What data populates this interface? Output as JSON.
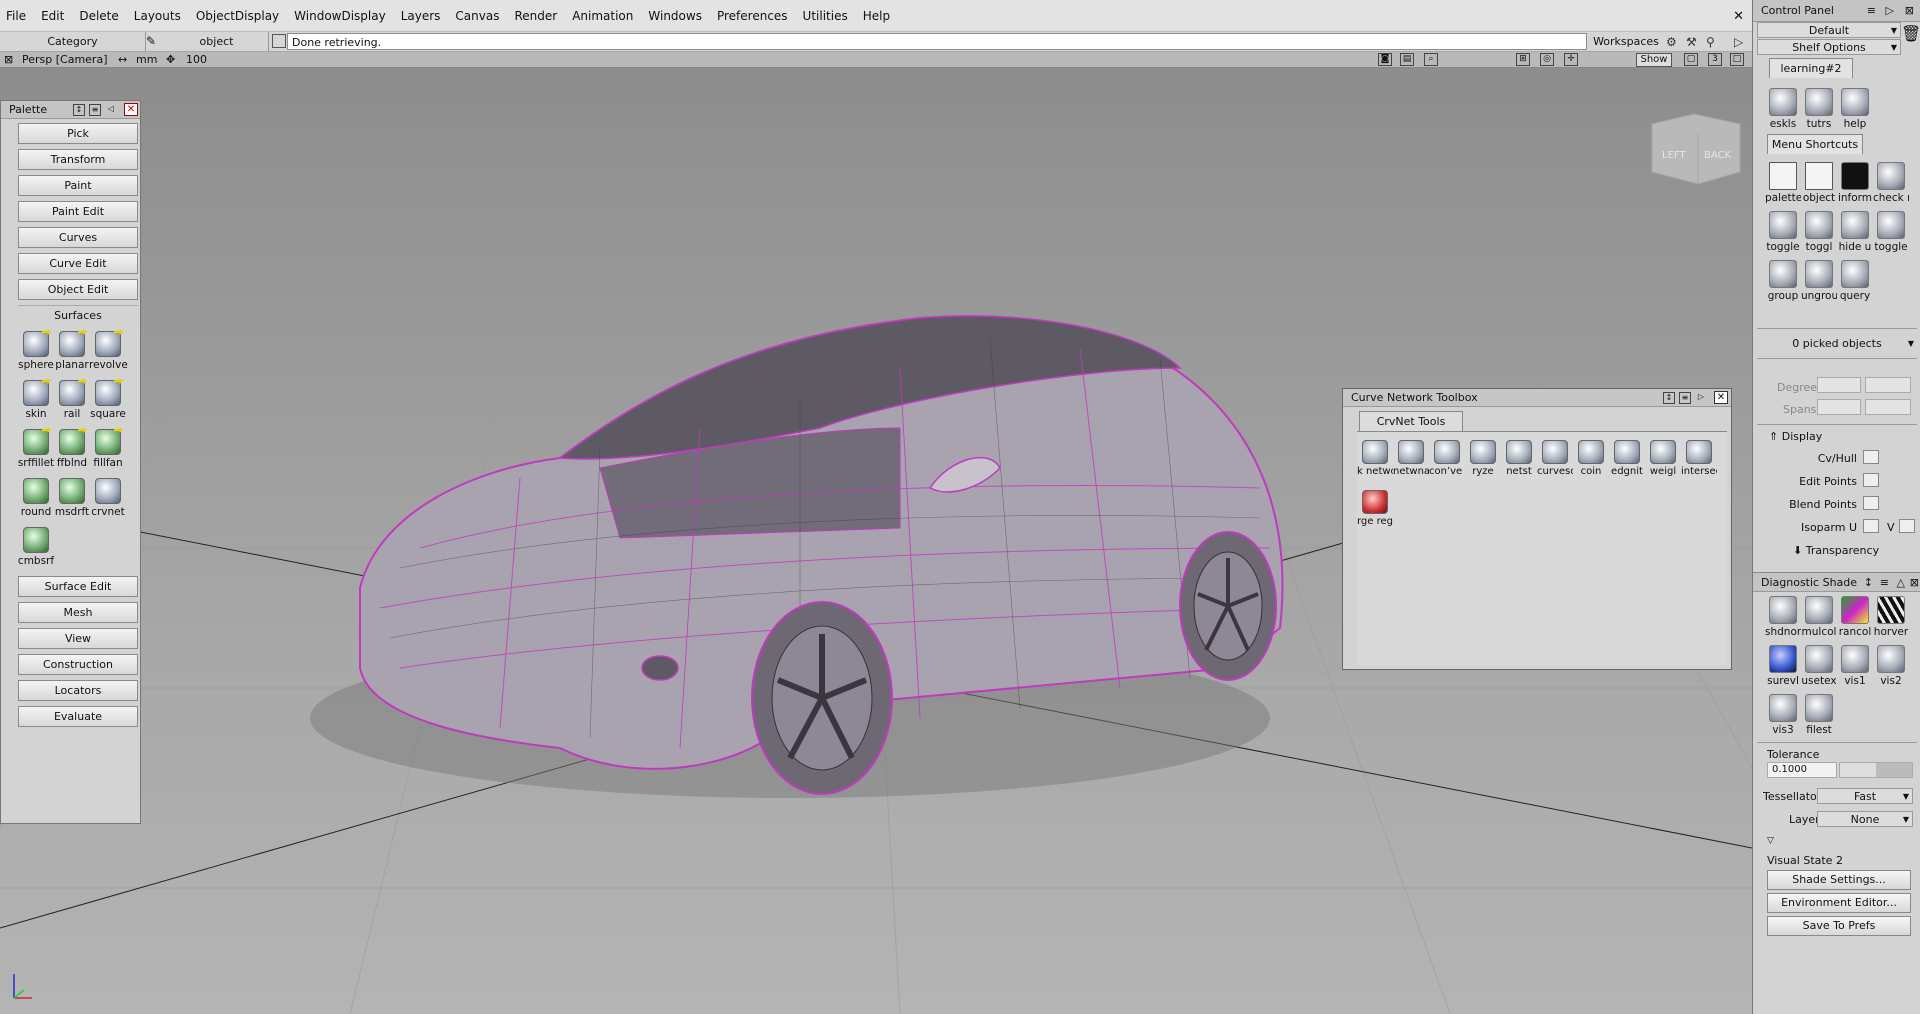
{
  "menubar": {
    "items": [
      "File",
      "Edit",
      "Delete",
      "Layouts",
      "ObjectDisplay",
      "WindowDisplay",
      "Layers",
      "Canvas",
      "Render",
      "Animation",
      "Windows",
      "Preferences",
      "Utilities",
      "Help"
    ]
  },
  "toolbar": {
    "category": "Category",
    "object": "object",
    "status": "Done retrieving.",
    "workspaces": "Workspaces"
  },
  "viewport": {
    "camera": "Persp [Camera]",
    "units": "mm",
    "scale": "100",
    "show_label": "Show",
    "view_count": "3",
    "view_cube_left": "LEFT",
    "view_cube_back": "BACK"
  },
  "palette": {
    "title": "Palette",
    "top_buttons": [
      "Pick",
      "Transform",
      "Paint",
      "Paint Edit",
      "Curves",
      "Curve Edit",
      "Object Edit"
    ],
    "active_section": "Surfaces",
    "surface_tools": [
      "sphere",
      "planar",
      "revolve",
      "skin",
      "rail",
      "square",
      "srffillet",
      "ffblnd",
      "fillfan",
      "round",
      "msdrft",
      "crvnet",
      "cmbsrf"
    ],
    "bottom_buttons": [
      "Surface Edit",
      "Mesh",
      "View",
      "Construction",
      "Locators",
      "Evaluate"
    ]
  },
  "curve_network_toolbox": {
    "title": "Curve Network Toolbox",
    "tab": "CrvNet Tools",
    "tools_row1": [
      "k netwo",
      "netwnal",
      "con’ve to",
      "ryze",
      "netst",
      "curvesculpt",
      "coin",
      "edgnit",
      "weigl",
      "intersec"
    ],
    "tools_row2": [
      "rge regi"
    ]
  },
  "control_panel": {
    "title": "Control Panel",
    "preset": "Default",
    "shelf_options": "Shelf Options",
    "shelf_tab": "learning#2",
    "shelf_icons": [
      "eskls",
      "tutrs",
      "help"
    ],
    "menu_shortcuts_tab": "Menu Shortcuts",
    "shortcuts": [
      "palette",
      "object",
      "inform",
      "check r",
      "toggle",
      "toggl",
      "hide u",
      "toggle",
      "group",
      "ungrou",
      "query"
    ],
    "picked": "0 picked objects",
    "degree_label": "Degree",
    "spans_label": "Spans",
    "display_section": "Display",
    "display_items": [
      "Cv/Hull",
      "Edit Points",
      "Blend Points",
      "Isoparm U"
    ],
    "isoparm_v": "V",
    "transparency": "Transparency",
    "diagnostic_title": "Diagnostic Shade",
    "diagnostic_icons": [
      "shdnon",
      "mulcol",
      "rancol",
      "horver",
      "surevl",
      "usetex",
      "vis1",
      "vis2",
      "vis3",
      "filest"
    ],
    "tolerance_label": "Tolerance",
    "tolerance_value": "0.1000",
    "tessellator_label": "Tessellator",
    "tessellator_value": "Fast",
    "layer_label": "Layer",
    "layer_value": "None",
    "visual_state": "Visual State 2",
    "buttons": [
      "Shade Settings...",
      "Environment Editor...",
      "Save To Prefs"
    ]
  }
}
